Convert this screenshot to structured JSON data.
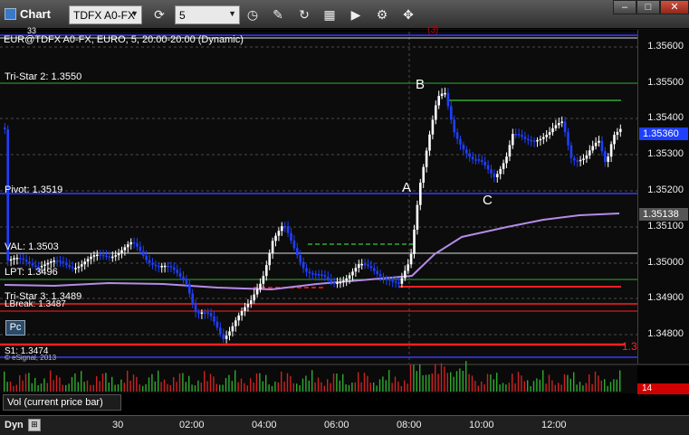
{
  "window": {
    "title": "Chart"
  },
  "toolbar": {
    "symbol": "TDFX A0-FX",
    "period": "5"
  },
  "chart": {
    "header": "EUR@TDFX A0-FX, EURO, 5, 20:00-20:00 (Dynamic)",
    "top_right_marker": "(3)",
    "top_left_fragment": "33",
    "labels": {
      "tristar2": "Tri-Star 2: 1.3550",
      "pivot": "Pivot: 1.3519",
      "val": "VAL: 1.3503",
      "lpt": "LPT: 1.3496",
      "tristar3": "Tri-Star 3: 1.3489",
      "lbreak": "LBreak: 1.3487",
      "s1": "S1: 1.3474",
      "copyright": "© eSignal, 2013",
      "right_partial": "1.3"
    },
    "waves": {
      "a": "A",
      "b": "B",
      "c": "C"
    },
    "price_ticks": [
      "1.35600",
      "1.35500",
      "1.35400",
      "1.35300",
      "1.35200",
      "1.35100",
      "1.35000",
      "1.34900",
      "1.34800"
    ],
    "badges": {
      "last": "1.35360",
      "ma": "1.35138"
    },
    "colors": {
      "up_candle": "#ffffff",
      "down_candle": "#1f3fff",
      "ma_line": "#b48ce8",
      "support": "#ff2020",
      "pivot": "#3a3aff",
      "tristar": "#33aa33"
    },
    "pc_button": "Pc"
  },
  "volume": {
    "label": "Vol (current price bar)",
    "value": "14"
  },
  "time_axis": {
    "mode": "Dyn",
    "ticks": [
      "30",
      "02:00",
      "04:00",
      "06:00",
      "08:00",
      "10:00",
      "12:00"
    ]
  }
}
